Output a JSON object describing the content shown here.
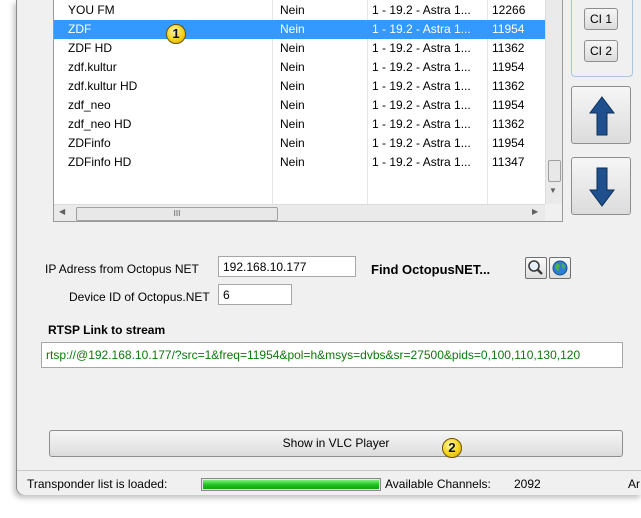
{
  "channels": [
    {
      "name": "YOU FM",
      "encrypted": "Nein",
      "transponder": "1 - 19.2 - Astra 1...",
      "frequency": "12266",
      "selected": false
    },
    {
      "name": "ZDF",
      "encrypted": "Nein",
      "transponder": "1 - 19.2 - Astra 1...",
      "frequency": "11954",
      "selected": true
    },
    {
      "name": "ZDF HD",
      "encrypted": "Nein",
      "transponder": "1 - 19.2 - Astra 1...",
      "frequency": "11362",
      "selected": false
    },
    {
      "name": "zdf.kultur",
      "encrypted": "Nein",
      "transponder": "1 - 19.2 - Astra 1...",
      "frequency": "11954",
      "selected": false
    },
    {
      "name": "zdf.kultur HD",
      "encrypted": "Nein",
      "transponder": "1 - 19.2 - Astra 1...",
      "frequency": "11362",
      "selected": false
    },
    {
      "name": "zdf_neo",
      "encrypted": "Nein",
      "transponder": "1 - 19.2 - Astra 1...",
      "frequency": "11954",
      "selected": false
    },
    {
      "name": "zdf_neo HD",
      "encrypted": "Nein",
      "transponder": "1 - 19.2 - Astra 1...",
      "frequency": "11362",
      "selected": false
    },
    {
      "name": "ZDFinfo",
      "encrypted": "Nein",
      "transponder": "1 - 19.2 - Astra 1...",
      "frequency": "11954",
      "selected": false
    },
    {
      "name": "ZDFinfo HD",
      "encrypted": "Nein",
      "transponder": "1 - 19.2 - Astra 1...",
      "frequency": "11347",
      "selected": false
    }
  ],
  "scroll": {
    "thumb_glyph": "III"
  },
  "ci_buttons": {
    "ci1": "CI 1",
    "ci2": "CI 2"
  },
  "form": {
    "ip_label": "IP Adress from Octopus NET",
    "ip_value": "192.168.10.177",
    "find_label": "Find OctopusNET...",
    "device_label": "Device ID of Octopus.NET",
    "device_value": "6",
    "rtsp_label": "RTSP Link to stream",
    "rtsp_value": "rtsp://@192.168.10.177/?src=1&freq=11954&pol=h&msys=dvbs&sr=27500&pids=0,100,110,130,120"
  },
  "vlc_button": "Show in VLC Player",
  "status": {
    "loaded_label": "Transponder list is loaded:",
    "progress": 1.0,
    "channels_label": "Available Channels:",
    "channels_count": "2092",
    "truncated": "Ar"
  },
  "markers": {
    "m1": "1",
    "m2": "2"
  },
  "colors": {
    "selection": "#3399ff",
    "progress": "#1fbf1f",
    "rtsp_text": "#0a7a0a",
    "arrow": "#1f4f8c"
  },
  "icons": [
    "search-icon",
    "globe-icon",
    "arrow-up-icon",
    "arrow-down-icon",
    "scroll-left-icon",
    "scroll-right-icon",
    "scroll-down-icon"
  ]
}
